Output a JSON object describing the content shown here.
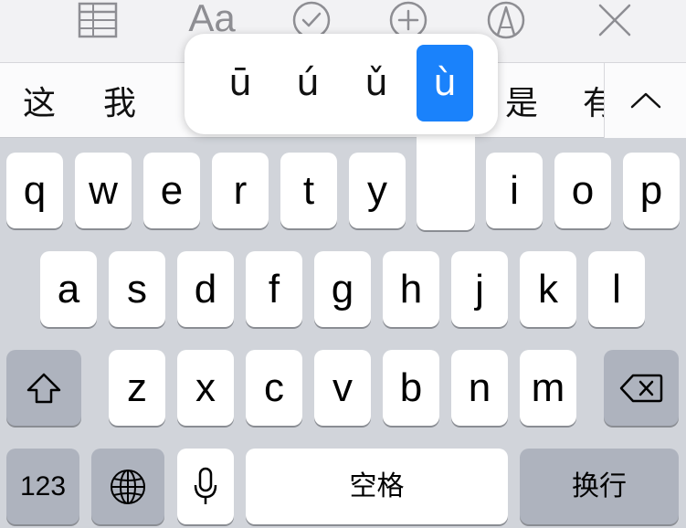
{
  "colors": {
    "keyboard_bg": "#d1d4da",
    "key": "#ffffff",
    "function_key": "#aeb3be",
    "accent_selected": "#1a82fb",
    "toolbar_icon": "#8e8e93"
  },
  "toolbar": {
    "icons": [
      "table-icon",
      "text-format-icon",
      "checklist-icon",
      "add-icon",
      "markup-icon",
      "close-icon"
    ],
    "format_label": "Aa"
  },
  "candidates": {
    "items": [
      "这",
      "我",
      "是",
      "有"
    ]
  },
  "accent_popup": {
    "options": [
      "ū",
      "ú",
      "ǔ",
      "ù"
    ],
    "selected": "ù"
  },
  "keyboard": {
    "row1": [
      "q",
      "w",
      "e",
      "r",
      "t",
      "y",
      "i",
      "o",
      "p"
    ],
    "row2": [
      "a",
      "s",
      "d",
      "f",
      "g",
      "h",
      "j",
      "k",
      "l"
    ],
    "row3": [
      "z",
      "x",
      "c",
      "v",
      "b",
      "n",
      "m"
    ],
    "numbers_label": "123",
    "space_label": "空格",
    "return_label": "换行"
  }
}
